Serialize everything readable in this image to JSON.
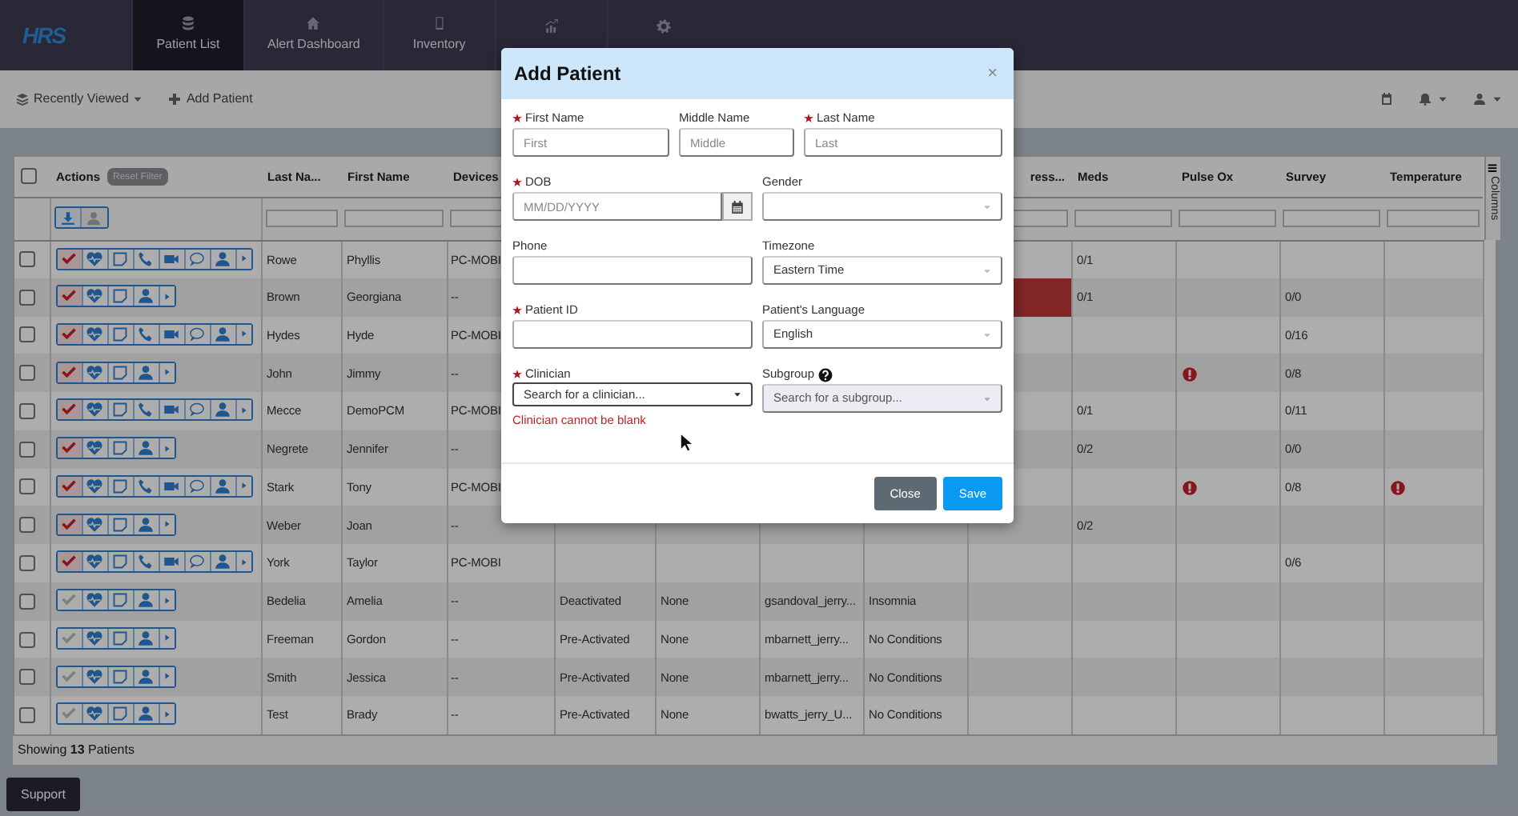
{
  "logo": "HRS",
  "nav": [
    {
      "label": "Patient List",
      "selected": true
    },
    {
      "label": "Alert Dashboard",
      "selected": false
    },
    {
      "label": "Inventory",
      "selected": false
    },
    {
      "selected": false
    },
    {
      "selected": false
    }
  ],
  "toolbar": {
    "recent": "Recently Viewed",
    "add": "Add Patient"
  },
  "table": {
    "select_all_checked": false,
    "reset_filter": "Reset Filter",
    "actions_label": "Actions",
    "columns_tab": "Columns",
    "columns": [
      "Last Na...",
      "First Name",
      "Devices",
      "ress...",
      "Meds",
      "Pulse Ox",
      "Survey",
      "Temperature"
    ],
    "rows": [
      {
        "active": true,
        "kind": "full",
        "last_name": "Rowe",
        "first_name": "Phyllis",
        "devices": "PC-MOBI",
        "meds": "0/1",
        "column_10_alert": false,
        "pulse_ox_alert": false,
        "temperature_alert": false
      },
      {
        "active": true,
        "kind": "basic",
        "last_name": "Brown",
        "first_name": "Georgiana",
        "devices": "--",
        "meds": "0/1",
        "survey": "0/0",
        "column_10_alert": true,
        "pulse_ox_alert": false,
        "temperature_alert": false
      },
      {
        "active": true,
        "kind": "full",
        "last_name": "Hydes",
        "first_name": "Hyde",
        "devices": "PC-MOBI",
        "survey": "0/16",
        "column_10_alert": false,
        "pulse_ox_alert": false,
        "temperature_alert": false
      },
      {
        "active": true,
        "kind": "basic",
        "last_name": "John",
        "first_name": "Jimmy",
        "devices": "--",
        "survey": "0/8",
        "column_10_alert": false,
        "pulse_ox_alert": true,
        "temperature_alert": false
      },
      {
        "active": true,
        "kind": "full",
        "last_name": "Mecce",
        "first_name": "DemoPCM",
        "devices": "PC-MOBI",
        "meds": "0/1",
        "survey": "0/11",
        "column_10_alert": false,
        "pulse_ox_alert": false,
        "temperature_alert": false
      },
      {
        "active": true,
        "kind": "basic",
        "last_name": "Negrete",
        "first_name": "Jennifer",
        "devices": "--",
        "meds": "0/2",
        "survey": "0/0",
        "column_10_alert": false,
        "pulse_ox_alert": false,
        "temperature_alert": false
      },
      {
        "active": true,
        "kind": "full",
        "last_name": "Stark",
        "first_name": "Tony",
        "devices": "PC-MOBI",
        "survey": "0/8",
        "column_10_alert": false,
        "pulse_ox_alert": true,
        "temperature_alert": true
      },
      {
        "active": true,
        "kind": "basic",
        "last_name": "Weber",
        "first_name": "Joan",
        "devices": "--",
        "meds": "0/2",
        "column_10_alert": false,
        "pulse_ox_alert": false,
        "temperature_alert": false
      },
      {
        "active": true,
        "kind": "full",
        "last_name": "York",
        "first_name": "Taylor",
        "devices": "PC-MOBI",
        "survey": "0/6",
        "column_10_alert": false,
        "pulse_ox_alert": false,
        "temperature_alert": false
      },
      {
        "active": false,
        "kind": "basic",
        "last_name": "Bedelia",
        "first_name": "Amelia",
        "devices": "--",
        "column_6": "Deactivated",
        "column_7": "None",
        "column_8": "gsandoval_jerry...",
        "column_9": "Insomnia",
        "column_10_alert": false,
        "pulse_ox_alert": false,
        "temperature_alert": false
      },
      {
        "active": false,
        "kind": "basic",
        "last_name": "Freeman",
        "first_name": "Gordon",
        "devices": "--",
        "column_6": "Pre-Activated",
        "column_7": "None",
        "column_8": "mbarnett_jerry...",
        "column_9": "No Conditions",
        "column_10_alert": false,
        "pulse_ox_alert": false,
        "temperature_alert": false
      },
      {
        "active": false,
        "kind": "basic",
        "last_name": "Smith",
        "first_name": "Jessica",
        "devices": "--",
        "column_6": "Pre-Activated",
        "column_7": "None",
        "column_8": "mbarnett_jerry...",
        "column_9": "No Conditions",
        "column_10_alert": false,
        "pulse_ox_alert": false,
        "temperature_alert": false
      },
      {
        "active": false,
        "kind": "basic",
        "last_name": "Test",
        "first_name": "Brady",
        "devices": "--",
        "column_6": "Pre-Activated",
        "column_7": "None",
        "column_8": "bwatts_jerry_U...",
        "column_9": "No Conditions",
        "column_10_alert": false,
        "pulse_ox_alert": false,
        "temperature_alert": false
      }
    ],
    "footer": "Showing **13** Patients"
  },
  "support": "Support",
  "modal": {
    "title": "Add Patient",
    "close": "×",
    "field_rows": [
      [
        {
          "label": "First Name",
          "required": true,
          "kind": "text",
          "placeholder": "First"
        },
        {
          "label": "Middle Name",
          "required": false,
          "kind": "text",
          "placeholder": "Middle"
        },
        {
          "label": "Last Name",
          "required": true,
          "kind": "text",
          "placeholder": "Last"
        }
      ],
      [
        {
          "label": "DOB",
          "required": true,
          "kind": "date",
          "placeholder": "MM/DD/YYYY"
        },
        {
          "label": "Gender",
          "required": false,
          "kind": "select"
        }
      ],
      [
        {
          "label": "Phone",
          "required": false,
          "kind": "text"
        },
        {
          "label": "Timezone",
          "required": false,
          "kind": "select",
          "value": "Eastern Time"
        }
      ],
      [
        {
          "label": "Patient ID",
          "required": true,
          "kind": "text"
        },
        {
          "label": "Patient's Language",
          "required": false,
          "kind": "select",
          "value": "English"
        }
      ],
      [
        {
          "label": "Clinician",
          "required": true,
          "kind": "search",
          "placeholder": "Search for a clinician...",
          "disabled": false,
          "error": "Clinician cannot be blank"
        },
        {
          "label": "Subgroup",
          "required": false,
          "kind": "search",
          "placeholder": "Search for a subgroup...",
          "disabled": true,
          "help": true
        }
      ]
    ],
    "buttons": [
      {
        "label": "Close",
        "kind": "secondary"
      },
      {
        "label": "Save",
        "kind": "primary"
      }
    ]
  }
}
